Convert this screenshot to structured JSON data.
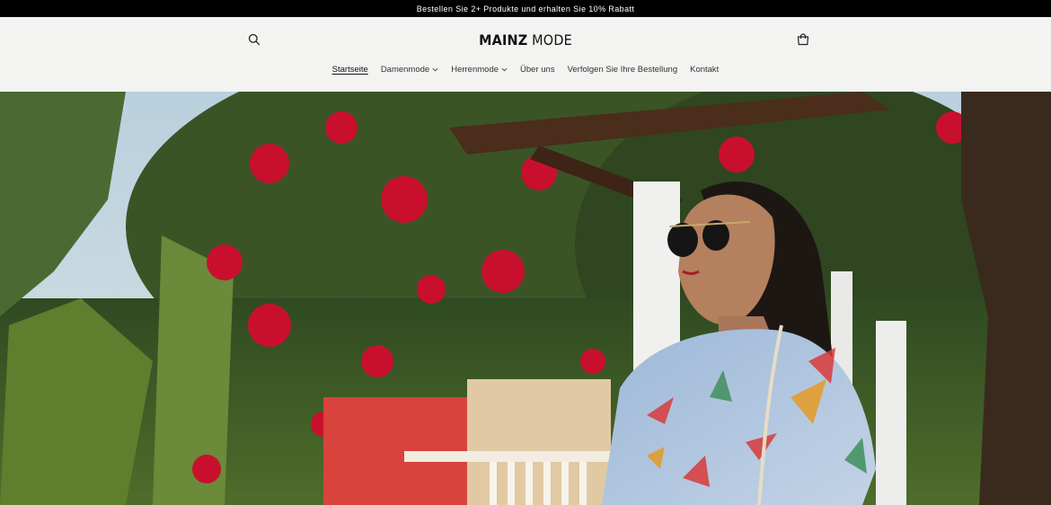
{
  "announcement": {
    "text": "Bestellen Sie 2+ Produkte und erhalten Sie 10% Rabatt"
  },
  "header": {
    "logo_bold": "MAINZ",
    "logo_light": "MODE",
    "search_icon": "search-icon",
    "cart_icon": "cart-icon"
  },
  "nav": {
    "items": [
      {
        "label": "Startseite",
        "active": true
      },
      {
        "label": "Damenmode",
        "dropdown": true
      },
      {
        "label": "Herrenmode",
        "dropdown": true
      },
      {
        "label": "Über uns"
      },
      {
        "label": "Verfolgen Sie Ihre Bestellung"
      },
      {
        "label": "Kontakt"
      }
    ]
  },
  "hero": {
    "image": "woman-in-sunglasses-under-flowering-tree"
  }
}
